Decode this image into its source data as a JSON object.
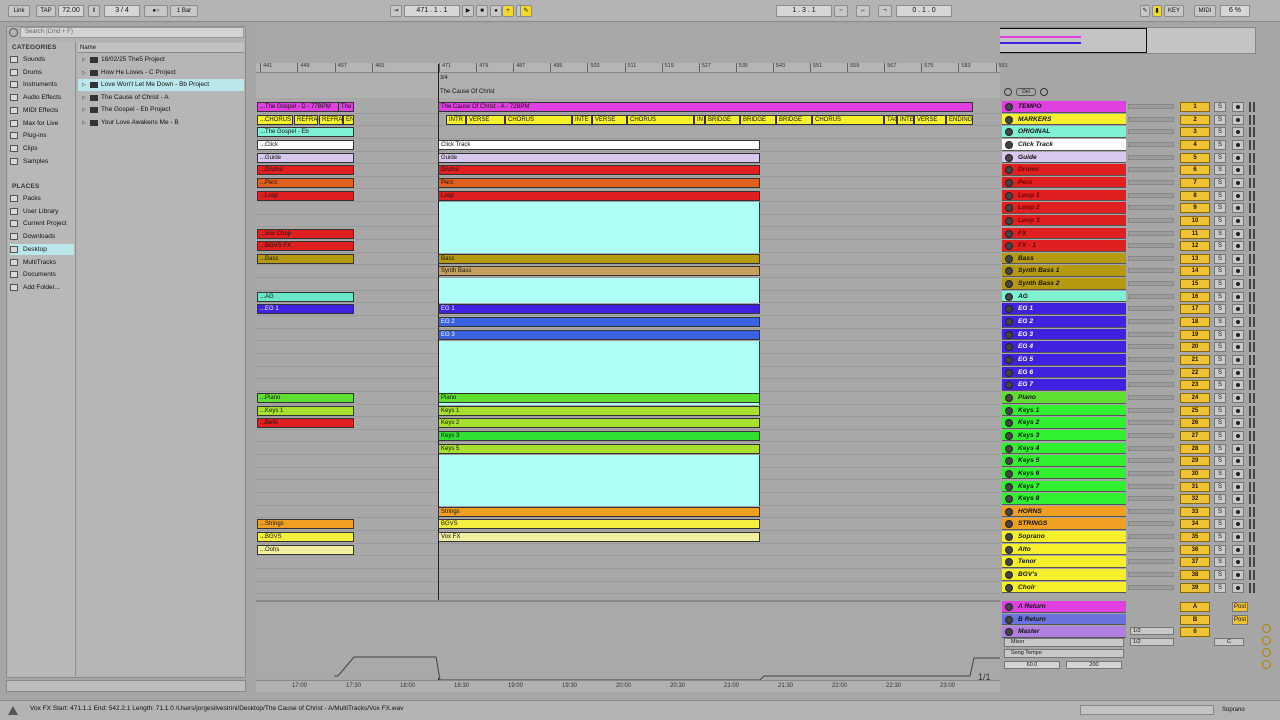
{
  "control_bar": {
    "link": "Link",
    "tap": "TAP",
    "tempo": "72.00",
    "meter": "3 / 4",
    "quant": "1 Bar",
    "position": "471 . 1 . 1",
    "loop_start": "1 . 3 . 1",
    "loop_len": "0 . 1 . 0",
    "key": "KEY",
    "midi": "MIDI",
    "cpu": "6 %"
  },
  "browser": {
    "search_placeholder": "Search (Cmd + F)",
    "categories_title": "CATEGORIES",
    "name_header": "Name",
    "places_title": "PLACES",
    "categories": [
      "Sounds",
      "Drums",
      "Instruments",
      "Audio Effects",
      "MIDI Effects",
      "Max for Live",
      "Plug-ins",
      "Clips",
      "Samples"
    ],
    "places": [
      "Packs",
      "User Library",
      "Current Project",
      "Downloads",
      "Desktop",
      "MultiTracks",
      "Documents",
      "Add Folder..."
    ],
    "files": [
      "18/02/25 The5 Project",
      "How He Loves - C Project",
      "Love Won't Let Me Down - Bb Project",
      "The Cause of Christ - A",
      "The Gospel - Eb Project",
      "Your Love Awakens Me - B"
    ]
  },
  "ruler": {
    "bars": [
      "441",
      "449",
      "457",
      "465",
      "471",
      "479",
      "487",
      "495",
      "503",
      "511",
      "519",
      "527",
      "535",
      "543",
      "551",
      "559",
      "567",
      "575",
      "583",
      "591"
    ],
    "meter_marker": "3/4",
    "locator": "The Cause Of Christ"
  },
  "left_clips": [
    {
      "text": "...The Gospel - D - 77BPM",
      "row": 0,
      "color": "#e040e0"
    },
    {
      "text": "The G",
      "row": 0,
      "color": "#e040e0"
    },
    {
      "text": "...CHORUS",
      "row": 1,
      "color": "#f5f02a"
    },
    {
      "text": "REFRA",
      "row": 1,
      "color": "#f5f02a"
    },
    {
      "text": "REFRA",
      "row": 1,
      "color": "#f5f02a"
    },
    {
      "text": "EN",
      "row": 1,
      "color": "#f5f02a"
    },
    {
      "text": "...The Gospel - Eb",
      "row": 2,
      "color": "#7ff2d4"
    },
    {
      "text": "...Click",
      "row": 3,
      "color": "#ffffff"
    },
    {
      "text": "...Guide",
      "row": 4,
      "color": "#d8c8f0"
    },
    {
      "text": "...Drums",
      "row": 5,
      "color": "#e02020"
    },
    {
      "text": "...Perc",
      "row": 6,
      "color": "#e06020"
    },
    {
      "text": "...Loop",
      "row": 7,
      "color": "#e02020"
    },
    {
      "text": "...Vox Chop",
      "row": 10,
      "color": "#e02020"
    },
    {
      "text": "...BGVS FX",
      "row": 11,
      "color": "#e02020"
    },
    {
      "text": "...Bass",
      "row": 12,
      "color": "#b59a10"
    },
    {
      "text": "...AG",
      "row": 15,
      "color": "#6ae6c8"
    },
    {
      "text": "...EG 1",
      "row": 16,
      "color": "#3f22e0"
    },
    {
      "text": "...Piano",
      "row": 23,
      "color": "#5fe030"
    },
    {
      "text": "...Keys 1",
      "row": 24,
      "color": "#a8e030"
    },
    {
      "text": "...Bells",
      "row": 25,
      "color": "#e02020"
    },
    {
      "text": "...Strings",
      "row": 33,
      "color": "#f0a020"
    },
    {
      "text": "...BGVS",
      "row": 34,
      "color": "#f5f040"
    },
    {
      "text": "...Oohs",
      "row": 35,
      "color": "#f3efa0"
    }
  ],
  "main_clips": [
    {
      "text": "The Cause Of Christ - A - 72BPM",
      "row": 0,
      "color": "#e040e0"
    },
    {
      "text": "Click Track",
      "row": 3,
      "color": "#ffffff"
    },
    {
      "text": "Guide",
      "row": 4,
      "color": "#d8c8f0"
    },
    {
      "text": "Drums",
      "row": 5,
      "color": "#e02020"
    },
    {
      "text": "Perc",
      "row": 6,
      "color": "#e06020"
    },
    {
      "text": "Loop",
      "row": 7,
      "color": "#e02020"
    },
    {
      "text": "Bass",
      "row": 12,
      "color": "#b59a10"
    },
    {
      "text": "Synth Bass",
      "row": 13,
      "color": "#c8a060"
    },
    {
      "text": "EG 1",
      "row": 16,
      "color": "#3f22e0"
    },
    {
      "text": "EG 2",
      "row": 17,
      "color": "#3a62e0"
    },
    {
      "text": "EG 3",
      "row": 18,
      "color": "#3a62e0"
    },
    {
      "text": "Piano",
      "row": 23,
      "color": "#5fe030"
    },
    {
      "text": "Keys 1",
      "row": 24,
      "color": "#a8e030"
    },
    {
      "text": "Keys 2",
      "row": 25,
      "color": "#a8e030"
    },
    {
      "text": "Keys 3",
      "row": 26,
      "color": "#30e030"
    },
    {
      "text": "Keys 5",
      "row": 27,
      "color": "#a8e030"
    },
    {
      "text": "Strings",
      "row": 32,
      "color": "#f0a020"
    },
    {
      "text": "BGVS",
      "row": 33,
      "color": "#f5f040"
    },
    {
      "text": "Vox FX",
      "row": 34,
      "color": "#f3efa0"
    }
  ],
  "markers": [
    "INTR",
    "VERSE",
    "CHORUS",
    "INTE",
    "VERSE",
    "CHORUS",
    "IN",
    "BRIDGE",
    "BRIDGE",
    "BRIDGE",
    "CHORUS",
    "TAG",
    "INTE",
    "VERSE",
    "ENDING"
  ],
  "tracks": [
    {
      "name": "TEMPO",
      "color": "#e040e0",
      "num": "1"
    },
    {
      "name": "MARKERS",
      "color": "#f5f02a",
      "num": "2"
    },
    {
      "name": "ORIGINAL",
      "color": "#7ff2d4",
      "num": "3"
    },
    {
      "name": "Click Track",
      "color": "#ffffff",
      "num": "4"
    },
    {
      "name": "Guide",
      "color": "#d8c8f0",
      "num": "5"
    },
    {
      "name": "Drums",
      "color": "#e02020",
      "num": "6"
    },
    {
      "name": "Perc",
      "color": "#e02020",
      "num": "7"
    },
    {
      "name": "Loop 1",
      "color": "#e02020",
      "num": "8"
    },
    {
      "name": "Loop 2",
      "color": "#e02020",
      "num": "9"
    },
    {
      "name": "Loop 3",
      "color": "#e02020",
      "num": "10"
    },
    {
      "name": "FX",
      "color": "#e02020",
      "num": "11"
    },
    {
      "name": "FX - 1",
      "color": "#e02020",
      "num": "12"
    },
    {
      "name": "Bass",
      "color": "#b59a10",
      "num": "13"
    },
    {
      "name": "Synth Bass 1",
      "color": "#b59a10",
      "num": "14"
    },
    {
      "name": "Synth Bass 2",
      "color": "#b59a10",
      "num": "15"
    },
    {
      "name": "AG",
      "color": "#7ff2d4",
      "num": "16"
    },
    {
      "name": "EG 1",
      "color": "#3f22e0",
      "num": "17"
    },
    {
      "name": "EG 2",
      "color": "#3f22e0",
      "num": "18"
    },
    {
      "name": "EG 3",
      "color": "#3f22e0",
      "num": "19"
    },
    {
      "name": "EG 4",
      "color": "#3f22e0",
      "num": "20"
    },
    {
      "name": "EG 5",
      "color": "#3f22e0",
      "num": "21"
    },
    {
      "name": "EG 6",
      "color": "#3f22e0",
      "num": "22"
    },
    {
      "name": "EG 7",
      "color": "#3f22e0",
      "num": "23"
    },
    {
      "name": "Piano",
      "color": "#5fe030",
      "num": "24"
    },
    {
      "name": "Keys 1",
      "color": "#30f030",
      "num": "25"
    },
    {
      "name": "Keys 2",
      "color": "#30f030",
      "num": "26"
    },
    {
      "name": "Keys 3",
      "color": "#30f030",
      "num": "27"
    },
    {
      "name": "Keys 4",
      "color": "#30f030",
      "num": "28"
    },
    {
      "name": "Keys 5",
      "color": "#30f030",
      "num": "29"
    },
    {
      "name": "Keys 6",
      "color": "#30f030",
      "num": "30"
    },
    {
      "name": "Keys 7",
      "color": "#30f030",
      "num": "31"
    },
    {
      "name": "Keys 8",
      "color": "#30f030",
      "num": "32"
    },
    {
      "name": "HORNS",
      "color": "#f0a020",
      "num": "33"
    },
    {
      "name": "STRINGS",
      "color": "#f0a020",
      "num": "34"
    },
    {
      "name": "Soprano",
      "color": "#f5f02a",
      "num": "35"
    },
    {
      "name": "Alto",
      "color": "#f5f02a",
      "num": "36"
    },
    {
      "name": "Tenor",
      "color": "#f5f02a",
      "num": "37"
    },
    {
      "name": "BGV's",
      "color": "#f5f02a",
      "num": "38"
    },
    {
      "name": "Choir",
      "color": "#f5f02a",
      "num": "39"
    }
  ],
  "returns": [
    {
      "name": "A Return",
      "color": "#e040e0",
      "num": "A",
      "post": "Post"
    },
    {
      "name": "B Return",
      "color": "#6a72e0",
      "num": "B",
      "post": "Post"
    },
    {
      "name": "Master",
      "color": "#b080e0",
      "num": "0"
    }
  ],
  "master": {
    "mixer": "Mixer",
    "song_tempo": "Song Tempo",
    "tempo_low": "60.0",
    "tempo_high": "200",
    "io1": "1/2",
    "io2": "1/2",
    "c": "C",
    "page": "1/1"
  },
  "time_ticks": [
    "17:00",
    "17:30",
    "18:00",
    "18:30",
    "19:00",
    "19:30",
    "20:00",
    "20:30",
    "21:00",
    "21:30",
    "22:00",
    "22:30",
    "23:00"
  ],
  "status": "Vox FX  Start: 471.1.1  End: 542.2.1  Length: 71.1.0  /Users/jorgesilvestrini/Desktop/The Cause of Christ - A/MultiTracks/Vox FX.wav",
  "status_right": "Soprano"
}
